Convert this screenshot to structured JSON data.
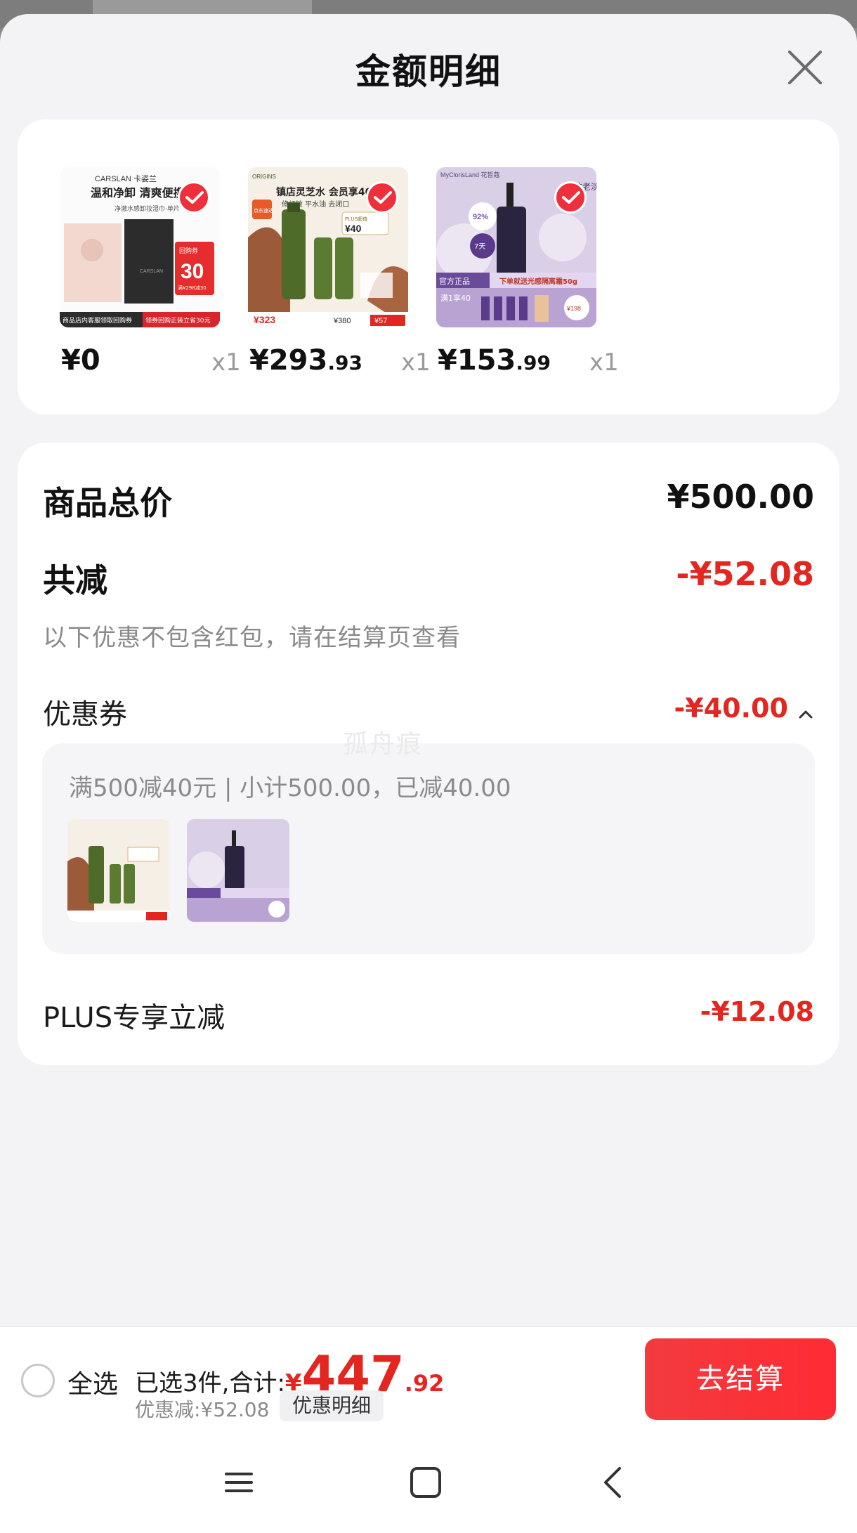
{
  "sheet": {
    "title": "金额明细"
  },
  "products": [
    {
      "price_int": "¥0",
      "price_dec": "",
      "qty": "x1",
      "thumb": {
        "brand": "CARSLAN 卡姿兰",
        "headline": "温和净卸 清爽便携",
        "sub": "净澈水感卸妆湿巾·单片",
        "badge_top": "回购券",
        "badge_num": "30",
        "badge_sub": "满¥298减30",
        "footer_left": "商品店内客服领取回购券",
        "footer_right": "领券回购正装立省30元"
      }
    },
    {
      "price_int": "¥293",
      "price_dec": ".93",
      "qty": "x1",
      "thumb": {
        "brand": "ORIGINS",
        "headline": "镇店灵芝水 会员享40",
        "sub": "修红敏 平水油 去闭口",
        "tag": "京东速达",
        "tag2": "限时破价",
        "plus": "PLUS超值",
        "plus_price": "¥40",
        "foot_price1": "¥323",
        "foot_price2": "¥380",
        "foot_price3": "¥57"
      }
    },
    {
      "price_int": "¥153",
      "price_dec": ".99",
      "qty": "x1",
      "thumb": {
        "brand": "MyClorisLand 花皙蔻",
        "side": "抗老淡纹",
        "pct": "92%",
        "days": "7天",
        "footer": "官方正品",
        "footer_right": "下单就送光感隔离霜50g",
        "promo": "满1享40",
        "price": "¥198"
      }
    }
  ],
  "summary": {
    "total_label": "商品总价",
    "total_value": "¥500.00",
    "reduce_label": "共减",
    "reduce_value": "-¥52.08",
    "note": "以下优惠不包含红包，请在结算页查看",
    "coupon_label": "优惠券",
    "coupon_value": "-¥40.00",
    "coupon_rule": "满500减40元 | 小计500.00，已减40.00",
    "plus_label": "PLUS专享立减",
    "plus_value": "-¥12.08"
  },
  "watermark": "孤舟痕",
  "bottom": {
    "select_all": "全选",
    "total_prefix": "已选3件,合计:",
    "total_yen": "¥",
    "total_int": "447",
    "total_dec": ".92",
    "discount": "优惠减:¥52.08",
    "detail_label": "优惠明细",
    "checkout_label": "去结算"
  },
  "colors": {
    "accent_red": "#e3261f",
    "button_red": "#f23b3f",
    "sheet_bg": "#f3f3f5"
  },
  "icons": [
    "close-icon",
    "checkmark-icon",
    "chevron-up-icon",
    "menu-icon",
    "home-icon",
    "back-icon"
  ]
}
